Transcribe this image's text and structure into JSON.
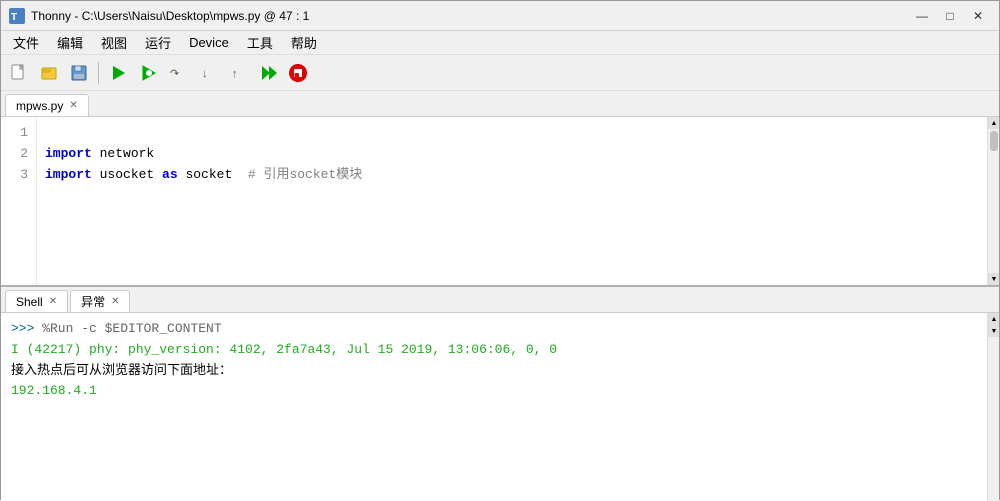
{
  "titlebar": {
    "icon": "🐍",
    "title": "Thonny  -  C:\\Users\\Naisu\\Desktop\\mpws.py  @  47 : 1",
    "minimize": "—",
    "maximize": "□",
    "close": "✕"
  },
  "menubar": {
    "items": [
      "文件",
      "编辑",
      "视图",
      "运行",
      "Device",
      "工具",
      "帮助"
    ]
  },
  "toolbar": {
    "buttons": [
      {
        "name": "new-btn",
        "icon": "📄"
      },
      {
        "name": "open-btn",
        "icon": "📂"
      },
      {
        "name": "save-btn",
        "icon": "💾"
      },
      {
        "name": "run-btn",
        "icon": "▶"
      },
      {
        "name": "debug-btn",
        "icon": "🐛"
      },
      {
        "name": "step-over-btn",
        "icon": "⟶"
      },
      {
        "name": "step-into-btn",
        "icon": "↓"
      },
      {
        "name": "step-out-btn",
        "icon": "↑"
      },
      {
        "name": "resume-btn",
        "icon": "⏩"
      },
      {
        "name": "stop-btn",
        "icon": "🔴"
      }
    ]
  },
  "editor": {
    "tab_label": "mpws.py",
    "lines": [
      {
        "num": "1",
        "tokens": [
          {
            "type": "kw",
            "text": "import"
          },
          {
            "type": "id",
            "text": " network"
          }
        ]
      },
      {
        "num": "2",
        "tokens": [
          {
            "type": "kw",
            "text": "import"
          },
          {
            "type": "id",
            "text": " usocket "
          },
          {
            "type": "kw",
            "text": "as"
          },
          {
            "type": "id",
            "text": " socket"
          },
          {
            "type": "comment",
            "text": "  # 引用socket模块"
          }
        ]
      },
      {
        "num": "3",
        "tokens": []
      }
    ]
  },
  "shell": {
    "tab_label": "Shell",
    "tab2_label": "异常",
    "prompt": ">>>",
    "command": " %Run -c $EDITOR_CONTENT",
    "info_line": "I (42217) phy: phy_version: 4102, 2fa7a43, Jul 15 2019, 13:06:06, 0, 0",
    "text_line": "接入热点后可从浏览器访问下面地址：",
    "ip_line": "192.168.4.1"
  },
  "colors": {
    "bg": "#f0f0f0",
    "editor_bg": "#ffffff",
    "keyword": "#0000cc",
    "comment": "#808080",
    "info_green": "#22aa22",
    "prompt_blue": "#005f87",
    "cmd_gray": "#666666"
  }
}
